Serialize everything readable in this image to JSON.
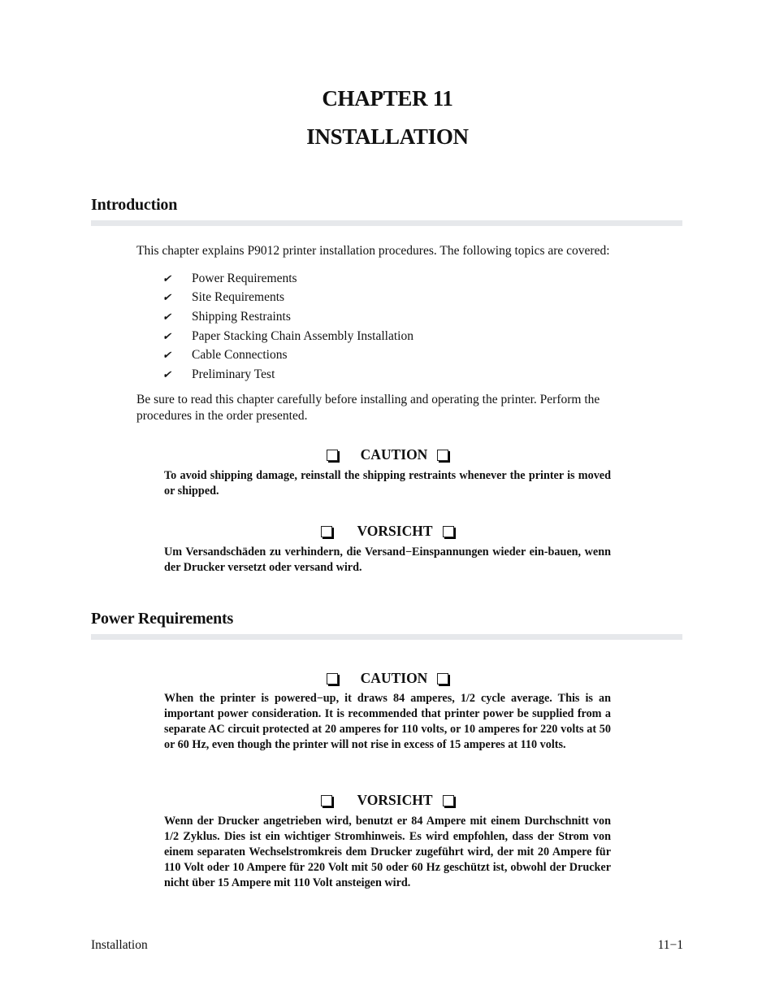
{
  "document": {
    "chapter_number": "CHAPTER 11",
    "chapter_title": "INSTALLATION"
  },
  "sections": {
    "introduction": {
      "heading": "Introduction",
      "intro_paragraph": "This chapter explains P9012 printer installation procedures. The following topics are covered:",
      "topics_icon": "check-mark-icon",
      "topics": [
        "Power Requirements",
        "Site Requirements",
        "Shipping Restraints",
        "Paper Stacking Chain Assembly Installation",
        "Cable Connections",
        "Preliminary Test"
      ],
      "closing_paragraph": "Be sure to read this chapter carefully before installing and operating the printer. Perform the procedures in the order presented.",
      "caution": {
        "title": "CAUTION",
        "text": "To avoid shipping damage, reinstall the shipping restraints whenever the printer is moved or shipped."
      },
      "vorsicht": {
        "title": "VORSICHT",
        "text": "Um Versandschäden zu verhindern, die Versand−Einspannungen wieder ein-bauen, wenn der Drucker versetzt oder versand wird."
      }
    },
    "power_requirements": {
      "heading": "Power Requirements",
      "caution": {
        "title": "CAUTION",
        "text": "When the printer is powered−up, it draws 84 amperes, 1/2 cycle average. This is an important power consideration. It is recommended  that printer power be supplied from a separate AC circuit protected at 20 amperes for 110 volts, or 10 amperes for 220 volts at 50 or 60 Hz, even though the printer will not rise in excess of 15 amperes at 110 volts."
      },
      "vorsicht": {
        "title": "VORSICHT",
        "text": "Wenn der Drucker angetrieben wird, benutzt er 84 Ampere mit einem Durchschnitt von 1/2 Zyklus. Dies ist ein wichtiger Stromhinweis. Es wird empfohlen, dass der Strom von einem separaten Wechselstromkreis dem Drucker zugeführt wird, der mit 20 Ampere für 110 Volt oder 10 Ampere für 220 Volt mit 50 oder 60 Hz geschützt ist, obwohl der Drucker nicht über 15 Ampere mit 110 Volt ansteigen wird."
      }
    }
  },
  "footer": {
    "left": "Installation",
    "right": "11−1"
  },
  "colors": {
    "section_rule": "#e6e8eb",
    "text": "#111111"
  }
}
